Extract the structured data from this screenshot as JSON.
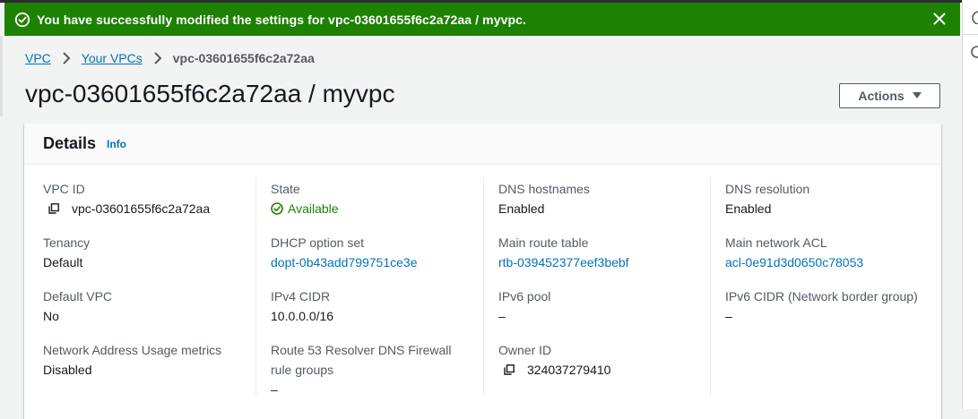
{
  "flash": {
    "message": "You have successfully modified the settings for vpc-03601655f6c2a72aa / myvpc.",
    "icon": "success-check-icon",
    "close_icon": "close-icon",
    "color": "#1d8102"
  },
  "breadcrumb": {
    "items": [
      "VPC",
      "Your VPCs"
    ],
    "current": "vpc-03601655f6c2a72aa"
  },
  "page": {
    "title": "vpc-03601655f6c2a72aa / myvpc",
    "actions_label": "Actions"
  },
  "details": {
    "title": "Details",
    "info_label": "Info",
    "vpc_id": {
      "label": "VPC ID",
      "value": "vpc-03601655f6c2a72aa"
    },
    "state": {
      "label": "State",
      "value": "Available"
    },
    "dns_hostnames": {
      "label": "DNS hostnames",
      "value": "Enabled"
    },
    "dns_resolution": {
      "label": "DNS resolution",
      "value": "Enabled"
    },
    "tenancy": {
      "label": "Tenancy",
      "value": "Default"
    },
    "dhcp_option_set": {
      "label": "DHCP option set",
      "value": "dopt-0b43add799751ce3e"
    },
    "main_route_table": {
      "label": "Main route table",
      "value": "rtb-039452377eef3bebf"
    },
    "main_network_acl": {
      "label": "Main network ACL",
      "value": "acl-0e91d3d0650c78053"
    },
    "default_vpc": {
      "label": "Default VPC",
      "value": "No"
    },
    "ipv4_cidr": {
      "label": "IPv4 CIDR",
      "value": "10.0.0.0/16"
    },
    "ipv6_pool": {
      "label": "IPv6 pool",
      "value": "–"
    },
    "ipv6_cidr": {
      "label": "IPv6 CIDR (Network border group)",
      "value": "–"
    },
    "nau_metrics": {
      "label": "Network Address Usage metrics",
      "value": "Disabled"
    },
    "route53_firewall": {
      "label_line1": "Route 53 Resolver DNS Firewall",
      "label_line2": "rule groups",
      "value": "–"
    },
    "owner_id": {
      "label": "Owner ID",
      "value": "324037279410"
    }
  },
  "colors": {
    "link": "#0073bb",
    "success": "#1d8102",
    "background": "#f2f3f3"
  }
}
